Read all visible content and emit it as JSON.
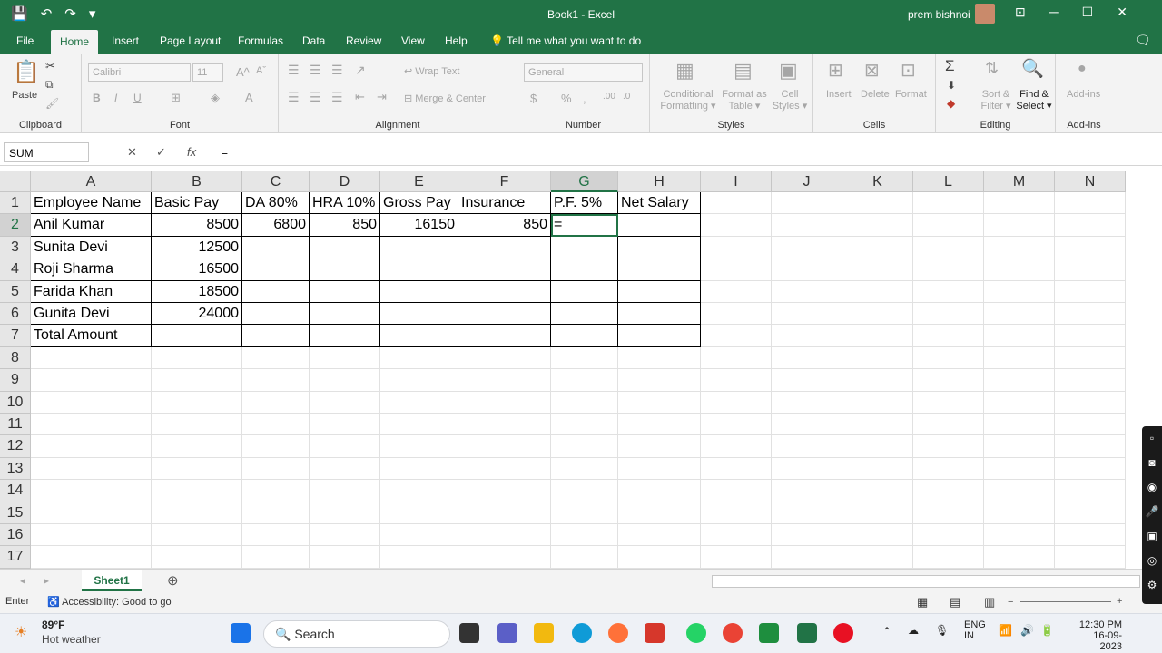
{
  "window": {
    "title": "Book1 - Excel",
    "user": "prem bishnoi",
    "quick_access": [
      "💾",
      "↶",
      "↷",
      "▾"
    ],
    "controls": [
      "⊡",
      "─",
      "☐",
      "✕"
    ]
  },
  "tabs": [
    "File",
    "Home",
    "Insert",
    "Page Layout",
    "Formulas",
    "Data",
    "Review",
    "View",
    "Help"
  ],
  "active_tab": "Home",
  "tell_me": "Tell me what you want to do",
  "ribbon": {
    "clipboard": {
      "label": "Clipboard",
      "paste": "Paste"
    },
    "font": {
      "label": "Font",
      "name": "Calibri",
      "size": "11"
    },
    "alignment": {
      "label": "Alignment",
      "wrap": "Wrap Text",
      "merge": "Merge & Center"
    },
    "number": {
      "label": "Number",
      "format": "General"
    },
    "styles": {
      "label": "Styles",
      "conditional": [
        "Conditional",
        "Formatting ▾"
      ],
      "format_table": [
        "Format as",
        "Table ▾"
      ],
      "cell_styles": [
        "Cell",
        "Styles ▾"
      ]
    },
    "cells": {
      "label": "Cells",
      "insert": "Insert",
      "delete": "Delete",
      "format": "Format"
    },
    "editing": {
      "label": "Editing",
      "sort": [
        "Sort &",
        "Filter ▾"
      ],
      "find": [
        "Find &",
        "Select ▾"
      ]
    },
    "addins": {
      "label": "Add-ins",
      "addins": "Add-ins"
    }
  },
  "formula_bar": {
    "name_box": "SUM",
    "formula": "=",
    "fx": "fx"
  },
  "columns": [
    "A",
    "B",
    "C",
    "D",
    "E",
    "F",
    "G",
    "H",
    "I",
    "J",
    "K",
    "L",
    "M",
    "N"
  ],
  "selected_column": "G",
  "selected_row": "2",
  "rows": [
    "1",
    "2",
    "3",
    "4",
    "5",
    "6",
    "7",
    "8",
    "9",
    "10",
    "11",
    "12",
    "13",
    "14",
    "15",
    "16",
    "17"
  ],
  "table": [
    [
      "Employee Name",
      "Basic Pay",
      "DA  80%",
      "HRA  10%",
      "Gross Pay",
      "Insurance",
      "P.F.  5%",
      "Net Salary"
    ],
    [
      "Anil Kumar",
      "8500",
      "6800",
      "850",
      "16150",
      "850",
      "=",
      ""
    ],
    [
      "Sunita Devi",
      "12500",
      "",
      "",
      "",
      "",
      "",
      ""
    ],
    [
      "Roji Sharma",
      "16500",
      "",
      "",
      "",
      "",
      "",
      ""
    ],
    [
      "Farida Khan",
      "18500",
      "",
      "",
      "",
      "",
      "",
      ""
    ],
    [
      "Gunita Devi",
      "24000",
      "",
      "",
      "",
      "",
      "",
      ""
    ],
    [
      "Total Amount",
      "",
      "",
      "",
      "",
      "",
      "",
      ""
    ]
  ],
  "sheet_tab": "Sheet1",
  "status": {
    "mode": "Enter",
    "accessibility": "Accessibility: Good to go"
  },
  "taskbar": {
    "temp": "89°F",
    "weather": "Hot weather",
    "search": "Search",
    "lang": [
      "ENG",
      "IN"
    ],
    "time": "12:30 PM",
    "date": "16-09-2023"
  },
  "colors": {
    "excel_green": "#217346"
  }
}
